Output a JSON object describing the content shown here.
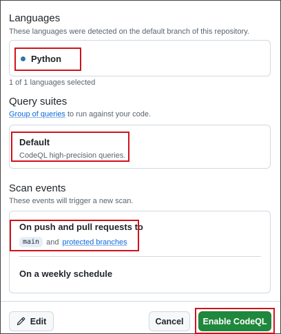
{
  "languages": {
    "title": "Languages",
    "description": "These languages were detected on the default branch of this repository.",
    "items": [
      {
        "name": "Python",
        "color": "#3572A5"
      }
    ],
    "selected_count": "1 of 1 languages selected"
  },
  "query_suites": {
    "title": "Query suites",
    "desc_link": "Group of queries",
    "desc_rest": " to run against your code.",
    "option_title": "Default",
    "option_desc": "CodeQL high-precision queries."
  },
  "scan_events": {
    "title": "Scan events",
    "description": "These events will trigger a new scan.",
    "push_title": "On push and pull requests to",
    "branch": "main",
    "and_text": "and",
    "protected_link": "protected branches",
    "schedule_title": "On a weekly schedule"
  },
  "footer": {
    "edit_label": "Edit",
    "edit_icon": "pencil-icon",
    "cancel_label": "Cancel",
    "enable_label": "Enable CodeQL"
  },
  "colors": {
    "highlight": "#d0111b",
    "primary": "#1f883d",
    "link": "#0969da"
  }
}
